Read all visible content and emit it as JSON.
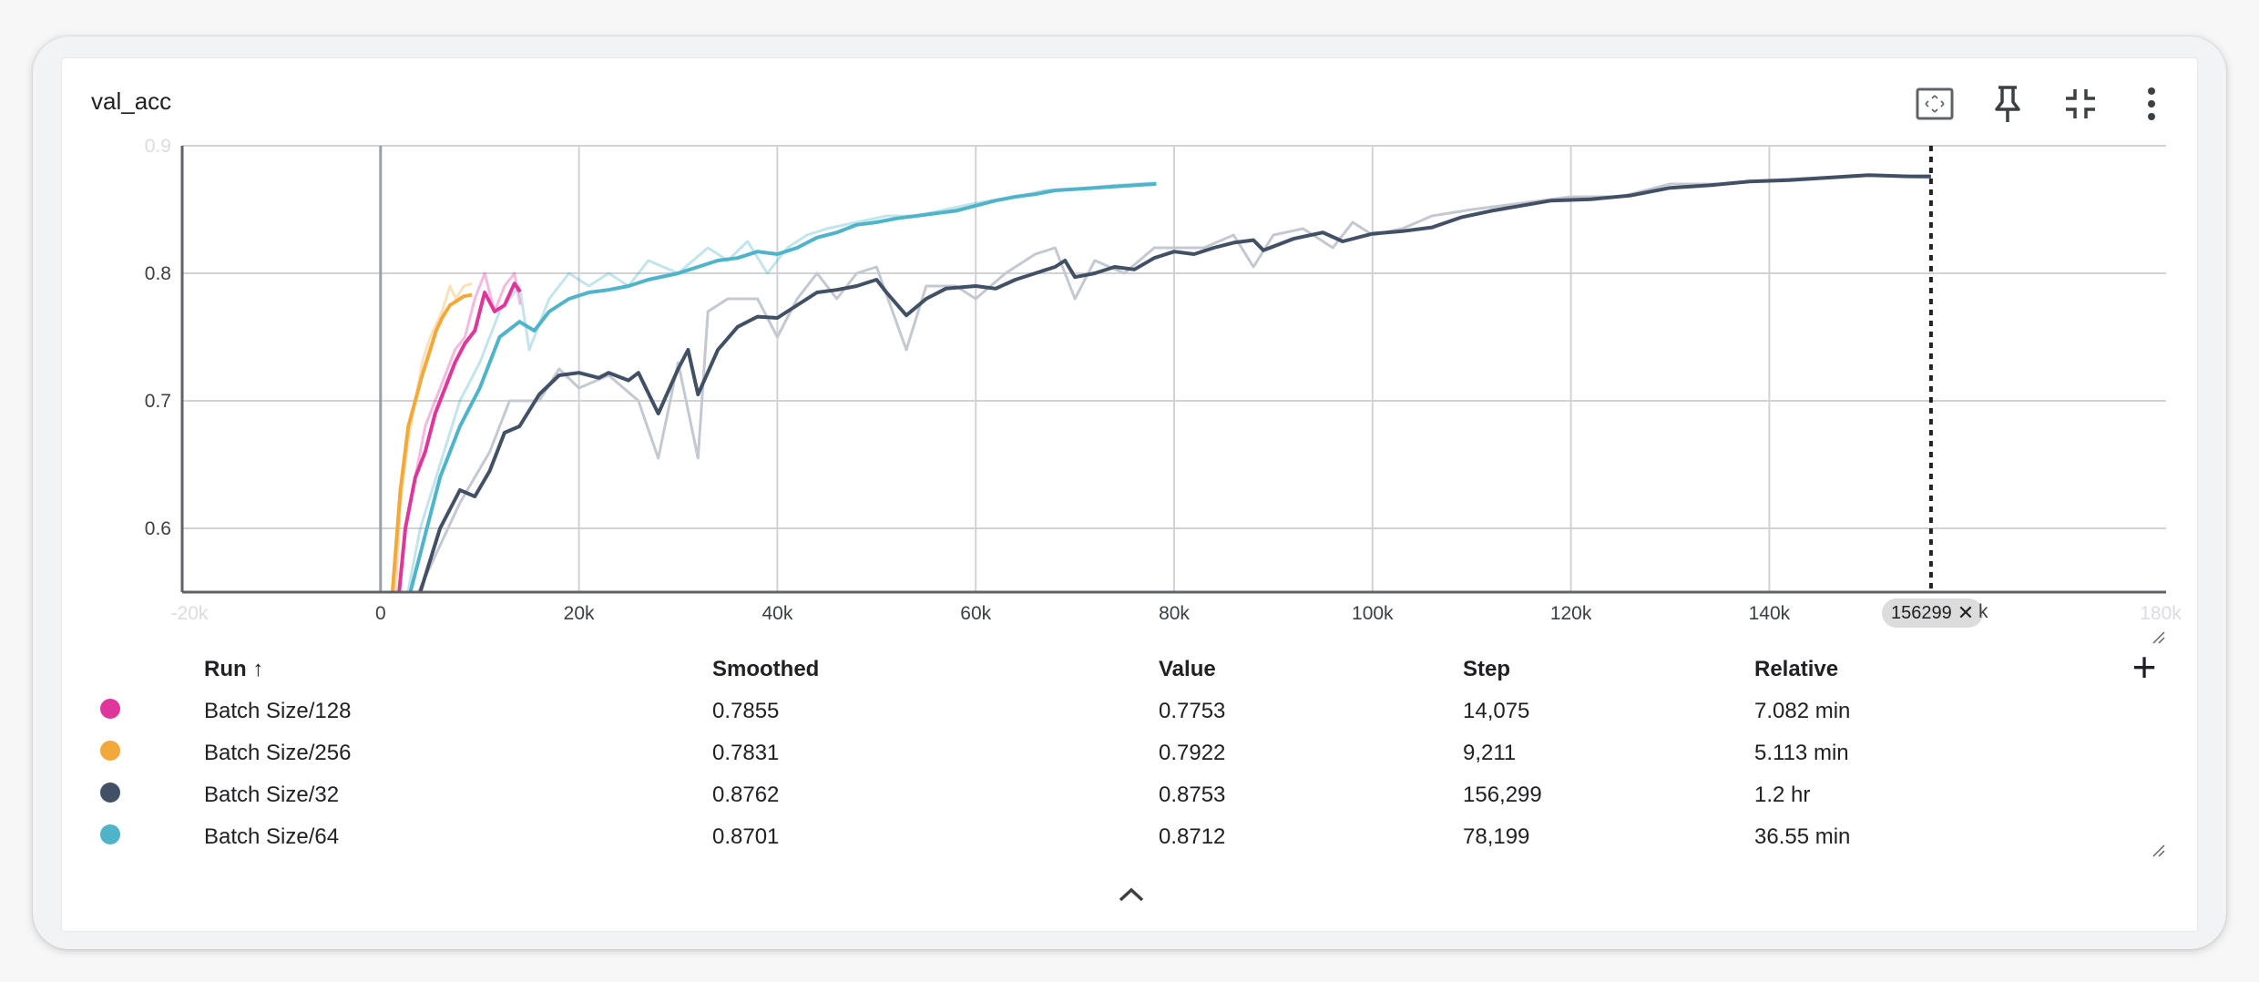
{
  "card": {
    "title": "val_acc"
  },
  "toolbar": {
    "fit_icon": "fit-to-domain-icon",
    "pin_icon": "pin-icon",
    "collapse_icon": "collapse-icon",
    "more_icon": "more-vert-icon"
  },
  "chart_data": {
    "type": "line",
    "title": "val_acc",
    "xlabel": "",
    "ylabel": "",
    "xlim": [
      -20000,
      180000
    ],
    "ylim": [
      0.55,
      0.9
    ],
    "x_ticks": [
      {
        "v": -20000,
        "label": "-20k",
        "faded": true
      },
      {
        "v": 0,
        "label": "0"
      },
      {
        "v": 20000,
        "label": "20k"
      },
      {
        "v": 40000,
        "label": "40k"
      },
      {
        "v": 60000,
        "label": "60k"
      },
      {
        "v": 80000,
        "label": "80k"
      },
      {
        "v": 100000,
        "label": "100k"
      },
      {
        "v": 120000,
        "label": "120k"
      },
      {
        "v": 140000,
        "label": "140k"
      },
      {
        "v": 180000,
        "label": "180k",
        "faded": true
      }
    ],
    "y_ticks": [
      {
        "v": 0.6,
        "label": "0.6"
      },
      {
        "v": 0.7,
        "label": "0.7"
      },
      {
        "v": 0.8,
        "label": "0.8"
      },
      {
        "v": 0.9,
        "label": "0.9",
        "faded": true
      }
    ],
    "grid": true,
    "cursor_step": 156299,
    "series": [
      {
        "name": "Batch Size/32",
        "color": "#425066",
        "raw": [
          [
            2000,
            0.52
          ],
          [
            5000,
            0.57
          ],
          [
            8000,
            0.62
          ],
          [
            11000,
            0.66
          ],
          [
            13000,
            0.7
          ],
          [
            16000,
            0.7
          ],
          [
            18000,
            0.725
          ],
          [
            20000,
            0.71
          ],
          [
            23000,
            0.72
          ],
          [
            26000,
            0.7
          ],
          [
            28000,
            0.655
          ],
          [
            30000,
            0.73
          ],
          [
            32000,
            0.655
          ],
          [
            33000,
            0.77
          ],
          [
            35000,
            0.78
          ],
          [
            38000,
            0.78
          ],
          [
            40000,
            0.75
          ],
          [
            42000,
            0.78
          ],
          [
            44000,
            0.8
          ],
          [
            46000,
            0.78
          ],
          [
            48000,
            0.8
          ],
          [
            50000,
            0.805
          ],
          [
            53000,
            0.74
          ],
          [
            55000,
            0.79
          ],
          [
            58000,
            0.79
          ],
          [
            60000,
            0.78
          ],
          [
            63000,
            0.8
          ],
          [
            66000,
            0.815
          ],
          [
            68000,
            0.82
          ],
          [
            70000,
            0.78
          ],
          [
            72000,
            0.81
          ],
          [
            75000,
            0.8
          ],
          [
            78000,
            0.82
          ],
          [
            80000,
            0.82
          ],
          [
            83000,
            0.82
          ],
          [
            86000,
            0.83
          ],
          [
            88000,
            0.805
          ],
          [
            90000,
            0.83
          ],
          [
            93000,
            0.835
          ],
          [
            96000,
            0.82
          ],
          [
            98000,
            0.84
          ],
          [
            100000,
            0.83
          ],
          [
            103000,
            0.835
          ],
          [
            106000,
            0.845
          ],
          [
            110000,
            0.85
          ],
          [
            115000,
            0.855
          ],
          [
            120000,
            0.86
          ],
          [
            125000,
            0.86
          ],
          [
            130000,
            0.87
          ],
          [
            135000,
            0.87
          ],
          [
            140000,
            0.873
          ],
          [
            145000,
            0.875
          ],
          [
            150000,
            0.877
          ],
          [
            156299,
            0.875
          ]
        ],
        "smoothed": [
          [
            2000,
            0.5
          ],
          [
            4000,
            0.55
          ],
          [
            6000,
            0.6
          ],
          [
            8000,
            0.63
          ],
          [
            9500,
            0.625
          ],
          [
            11000,
            0.645
          ],
          [
            12500,
            0.675
          ],
          [
            14000,
            0.68
          ],
          [
            16000,
            0.705
          ],
          [
            18000,
            0.72
          ],
          [
            20000,
            0.722
          ],
          [
            22000,
            0.718
          ],
          [
            23000,
            0.722
          ],
          [
            25000,
            0.716
          ],
          [
            26000,
            0.722
          ],
          [
            28000,
            0.69
          ],
          [
            30000,
            0.725
          ],
          [
            31000,
            0.74
          ],
          [
            32000,
            0.705
          ],
          [
            34000,
            0.74
          ],
          [
            36000,
            0.758
          ],
          [
            38000,
            0.766
          ],
          [
            40000,
            0.765
          ],
          [
            42000,
            0.775
          ],
          [
            44000,
            0.785
          ],
          [
            46000,
            0.787
          ],
          [
            48000,
            0.79
          ],
          [
            50000,
            0.795
          ],
          [
            51000,
            0.785
          ],
          [
            53000,
            0.767
          ],
          [
            55000,
            0.78
          ],
          [
            57000,
            0.788
          ],
          [
            60000,
            0.79
          ],
          [
            62000,
            0.788
          ],
          [
            64000,
            0.795
          ],
          [
            66000,
            0.8
          ],
          [
            68000,
            0.805
          ],
          [
            69000,
            0.81
          ],
          [
            70000,
            0.797
          ],
          [
            72000,
            0.8
          ],
          [
            74000,
            0.805
          ],
          [
            76000,
            0.803
          ],
          [
            78000,
            0.812
          ],
          [
            80000,
            0.817
          ],
          [
            82000,
            0.815
          ],
          [
            84000,
            0.82
          ],
          [
            86000,
            0.824
          ],
          [
            88000,
            0.826
          ],
          [
            89000,
            0.818
          ],
          [
            92000,
            0.827
          ],
          [
            95000,
            0.832
          ],
          [
            97000,
            0.825
          ],
          [
            100000,
            0.831
          ],
          [
            103000,
            0.833
          ],
          [
            106000,
            0.836
          ],
          [
            109000,
            0.844
          ],
          [
            112000,
            0.849
          ],
          [
            115000,
            0.853
          ],
          [
            118000,
            0.857
          ],
          [
            122000,
            0.858
          ],
          [
            126000,
            0.861
          ],
          [
            130000,
            0.867
          ],
          [
            134000,
            0.869
          ],
          [
            138000,
            0.872
          ],
          [
            142000,
            0.873
          ],
          [
            146000,
            0.875
          ],
          [
            150000,
            0.877
          ],
          [
            154000,
            0.876
          ],
          [
            156299,
            0.876
          ]
        ]
      },
      {
        "name": "Batch Size/64",
        "color": "#4fb4c9",
        "raw": [
          [
            2000,
            0.52
          ],
          [
            4000,
            0.6
          ],
          [
            6000,
            0.65
          ],
          [
            8000,
            0.7
          ],
          [
            10000,
            0.73
          ],
          [
            12000,
            0.77
          ],
          [
            14000,
            0.79
          ],
          [
            15000,
            0.74
          ],
          [
            17000,
            0.78
          ],
          [
            19000,
            0.8
          ],
          [
            21000,
            0.79
          ],
          [
            23000,
            0.8
          ],
          [
            25000,
            0.79
          ],
          [
            27000,
            0.81
          ],
          [
            30000,
            0.8
          ],
          [
            33000,
            0.82
          ],
          [
            35000,
            0.81
          ],
          [
            37000,
            0.825
          ],
          [
            39000,
            0.8
          ],
          [
            41000,
            0.82
          ],
          [
            43000,
            0.83
          ],
          [
            45000,
            0.835
          ],
          [
            48000,
            0.84
          ],
          [
            51000,
            0.845
          ],
          [
            54000,
            0.845
          ],
          [
            57000,
            0.85
          ],
          [
            60000,
            0.855
          ],
          [
            64000,
            0.86
          ],
          [
            67000,
            0.865
          ],
          [
            70000,
            0.866
          ],
          [
            74000,
            0.869
          ],
          [
            78199,
            0.871
          ]
        ],
        "smoothed": [
          [
            2000,
            0.52
          ],
          [
            4000,
            0.58
          ],
          [
            6000,
            0.64
          ],
          [
            8000,
            0.68
          ],
          [
            10000,
            0.71
          ],
          [
            12000,
            0.75
          ],
          [
            14000,
            0.762
          ],
          [
            15500,
            0.755
          ],
          [
            17000,
            0.77
          ],
          [
            19000,
            0.78
          ],
          [
            21000,
            0.785
          ],
          [
            23000,
            0.787
          ],
          [
            25000,
            0.79
          ],
          [
            27000,
            0.795
          ],
          [
            30000,
            0.8
          ],
          [
            32000,
            0.805
          ],
          [
            34000,
            0.81
          ],
          [
            36000,
            0.812
          ],
          [
            38000,
            0.817
          ],
          [
            40000,
            0.815
          ],
          [
            42000,
            0.82
          ],
          [
            44000,
            0.828
          ],
          [
            46000,
            0.832
          ],
          [
            48000,
            0.838
          ],
          [
            50000,
            0.84
          ],
          [
            52000,
            0.843
          ],
          [
            54000,
            0.845
          ],
          [
            56000,
            0.847
          ],
          [
            58000,
            0.849
          ],
          [
            60000,
            0.853
          ],
          [
            62000,
            0.857
          ],
          [
            64000,
            0.86
          ],
          [
            66000,
            0.862
          ],
          [
            68000,
            0.865
          ],
          [
            70000,
            0.866
          ],
          [
            72000,
            0.867
          ],
          [
            74000,
            0.868
          ],
          [
            76000,
            0.869
          ],
          [
            78199,
            0.8701
          ]
        ]
      },
      {
        "name": "Batch Size/256",
        "color": "#f3a93a",
        "raw": [
          [
            1200,
            0.5
          ],
          [
            2000,
            0.62
          ],
          [
            2800,
            0.67
          ],
          [
            3500,
            0.7
          ],
          [
            4200,
            0.73
          ],
          [
            5000,
            0.75
          ],
          [
            5600,
            0.76
          ],
          [
            6200,
            0.77
          ],
          [
            7000,
            0.79
          ],
          [
            7600,
            0.78
          ],
          [
            8400,
            0.79
          ],
          [
            9211,
            0.792
          ]
        ],
        "smoothed": [
          [
            1200,
            0.55
          ],
          [
            2000,
            0.63
          ],
          [
            2800,
            0.68
          ],
          [
            3500,
            0.7
          ],
          [
            4200,
            0.72
          ],
          [
            5000,
            0.74
          ],
          [
            5600,
            0.755
          ],
          [
            6200,
            0.765
          ],
          [
            7000,
            0.775
          ],
          [
            7600,
            0.778
          ],
          [
            8400,
            0.782
          ],
          [
            9211,
            0.7831
          ]
        ]
      },
      {
        "name": "Batch Size/128",
        "color": "#e0369c",
        "raw": [
          [
            1500,
            0.52
          ],
          [
            2500,
            0.6
          ],
          [
            3500,
            0.64
          ],
          [
            4500,
            0.68
          ],
          [
            5500,
            0.7
          ],
          [
            6500,
            0.72
          ],
          [
            7500,
            0.74
          ],
          [
            8500,
            0.75
          ],
          [
            9500,
            0.78
          ],
          [
            10500,
            0.8
          ],
          [
            11500,
            0.77
          ],
          [
            12500,
            0.79
          ],
          [
            13500,
            0.8
          ],
          [
            14075,
            0.7753
          ]
        ],
        "smoothed": [
          [
            1500,
            0.52
          ],
          [
            2500,
            0.6
          ],
          [
            3500,
            0.64
          ],
          [
            4500,
            0.66
          ],
          [
            5500,
            0.69
          ],
          [
            6500,
            0.71
          ],
          [
            7500,
            0.73
          ],
          [
            8500,
            0.745
          ],
          [
            9500,
            0.755
          ],
          [
            10500,
            0.785
          ],
          [
            11500,
            0.77
          ],
          [
            12500,
            0.775
          ],
          [
            13500,
            0.792
          ],
          [
            14075,
            0.7855
          ]
        ]
      }
    ]
  },
  "marker": {
    "value": "156299",
    "close": "✕",
    "tick_suffix": "k"
  },
  "table": {
    "headers": {
      "run": "Run ↑",
      "smoothed": "Smoothed",
      "value": "Value",
      "step": "Step",
      "relative": "Relative"
    },
    "rows": [
      {
        "color": "#e0369c",
        "run": "Batch Size/128",
        "smoothed": "0.7855",
        "value": "0.7753",
        "step": "14,075",
        "relative": "7.082 min"
      },
      {
        "color": "#f3a93a",
        "run": "Batch Size/256",
        "smoothed": "0.7831",
        "value": "0.7922",
        "step": "9,211",
        "relative": "5.113 min"
      },
      {
        "color": "#425066",
        "run": "Batch Size/32",
        "smoothed": "0.8762",
        "value": "0.8753",
        "step": "156,299",
        "relative": "1.2 hr"
      },
      {
        "color": "#4fb4c9",
        "run": "Batch Size/64",
        "smoothed": "0.8701",
        "value": "0.8712",
        "step": "78,199",
        "relative": "36.55 min"
      }
    ],
    "add_label": "+",
    "collapse_icon": "chevron-up-icon"
  }
}
